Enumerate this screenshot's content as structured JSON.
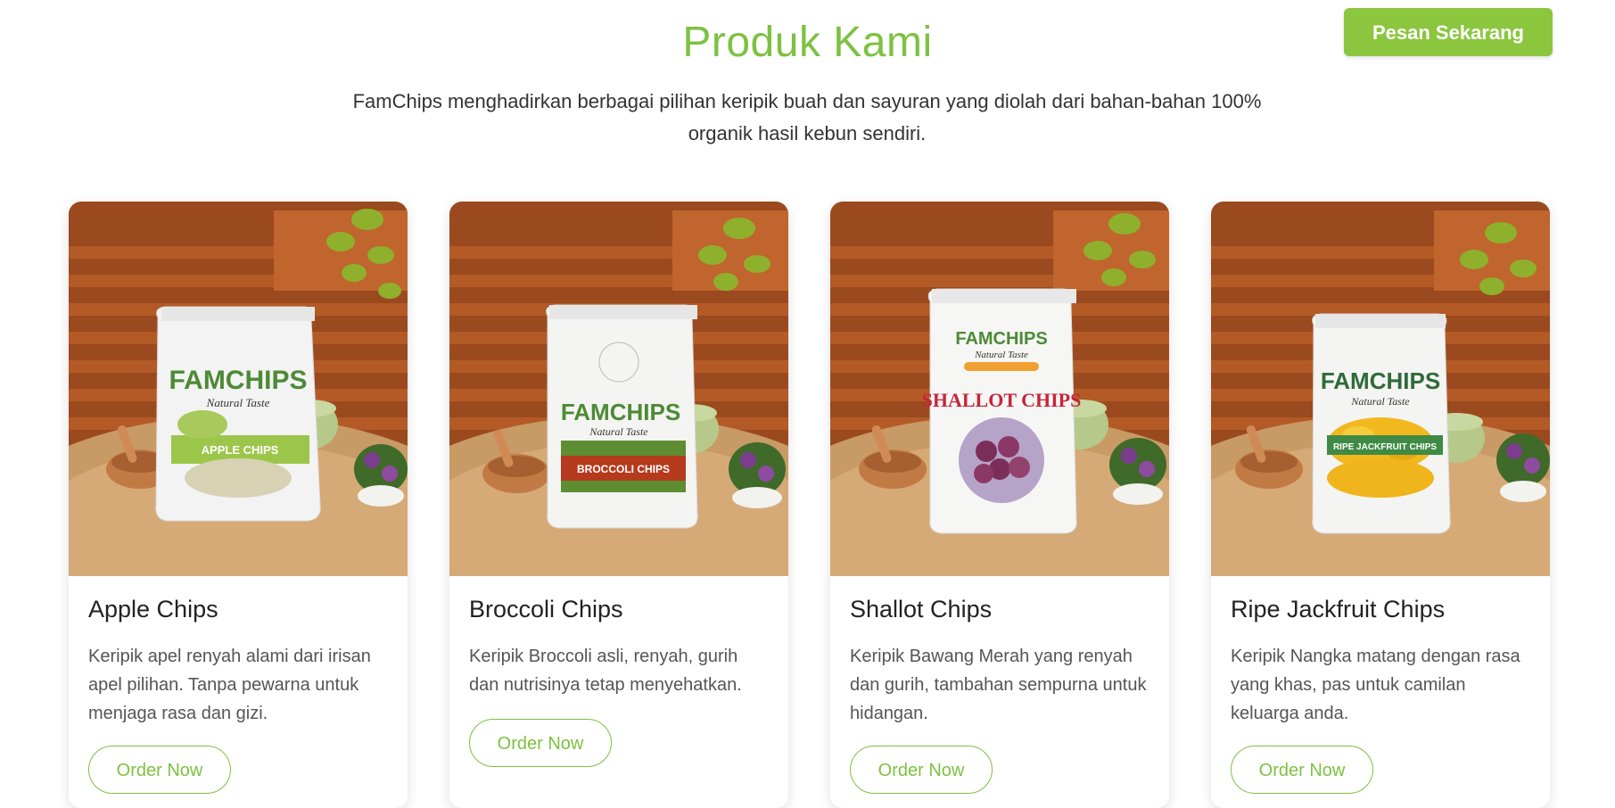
{
  "header": {
    "cta_label": "Pesan Sekarang",
    "title": "Produk Kami",
    "subtitle": "FamChips menghadirkan berbagai pilihan keripik buah dan sayuran yang diolah dari bahan-bahan 100% organik hasil kebun sendiri."
  },
  "colors": {
    "brand_green": "#8cc63f",
    "title_green": "#7dc142"
  },
  "products": [
    {
      "name": "Apple Chips",
      "description": "Keripik apel renyah alami dari irisan apel pilihan. Tanpa pewarna untuk menjaga rasa dan gizi.",
      "button_label": "Order Now",
      "package_brand": "FAMCHIPS",
      "package_tagline": "Natural Taste",
      "package_label": "APPLE CHIPS"
    },
    {
      "name": "Broccoli Chips",
      "description": "Keripik Broccoli asli, renyah, gurih dan nutrisinya tetap menyehatkan.",
      "button_label": "Order Now",
      "package_brand": "FAMCHIPS",
      "package_tagline": "Natural Taste",
      "package_label": "BROCCOLI CHIPS"
    },
    {
      "name": "Shallot Chips",
      "description": "Keripik Bawang Merah yang renyah dan gurih, tambahan sempurna untuk hidangan.",
      "button_label": "Order Now",
      "package_brand": "FAMCHIPS",
      "package_tagline": "Natural Taste",
      "package_label": "SHALLOT CHIPS"
    },
    {
      "name": "Ripe Jackfruit Chips",
      "description": "Keripik Nangka matang dengan rasa yang khas, pas untuk camilan keluarga anda.",
      "button_label": "Order Now",
      "package_brand": "FAMCHIPS",
      "package_tagline": "Natural Taste",
      "package_label": "RIPE JACKFRUIT CHIPS"
    }
  ]
}
